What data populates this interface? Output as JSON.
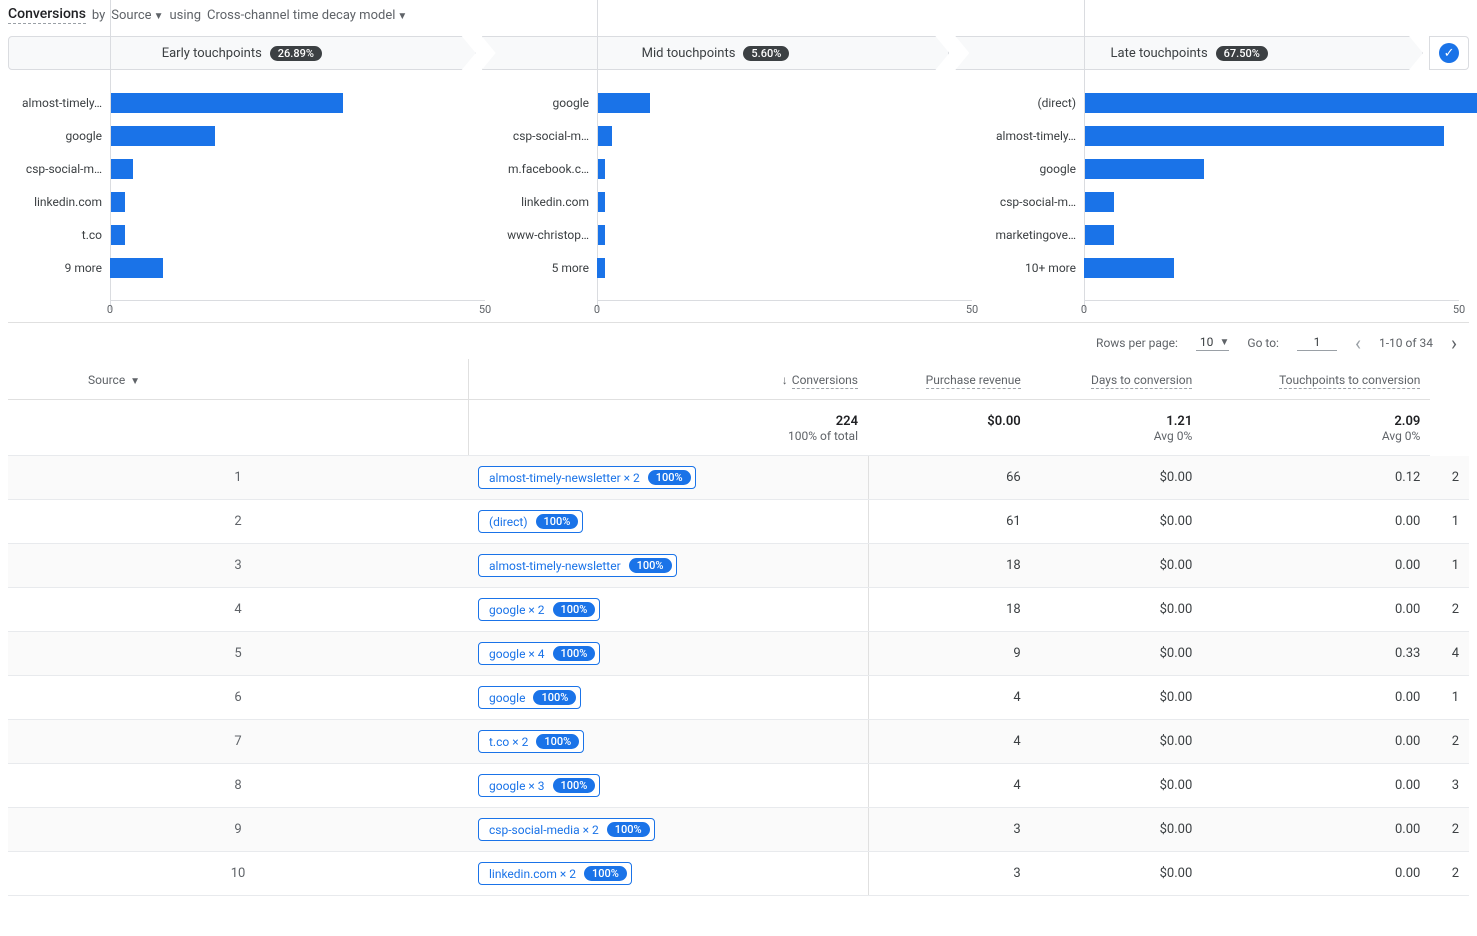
{
  "header": {
    "title_prefix": "Conversions",
    "by": "by",
    "dimension": "Source",
    "using": "using",
    "model": "Cross-channel time decay model"
  },
  "tabs": {
    "early": {
      "label": "Early touchpoints",
      "percent": "26.89%"
    },
    "mid": {
      "label": "Mid touchpoints",
      "percent": "5.60%"
    },
    "late": {
      "label": "Late touchpoints",
      "percent": "67.50%"
    }
  },
  "chart_data": [
    {
      "type": "bar",
      "name": "early",
      "xlim": [
        0,
        50
      ],
      "ticks": [
        0,
        50
      ],
      "categories": [
        "almost-timely…",
        "google",
        "csp-social-m…",
        "linkedin.com",
        "t.co",
        "9 more"
      ],
      "values": [
        31,
        14,
        3,
        2,
        2,
        7
      ]
    },
    {
      "type": "bar",
      "name": "mid",
      "xlim": [
        0,
        50
      ],
      "ticks": [
        0,
        50
      ],
      "categories": [
        "google",
        "csp-social-m…",
        "m.facebook.c…",
        "linkedin.com",
        "www-christop…",
        "5 more"
      ],
      "values": [
        7,
        2,
        1,
        1,
        1,
        1
      ]
    },
    {
      "type": "bar",
      "name": "late",
      "xlim": [
        0,
        50
      ],
      "ticks": [
        0,
        50
      ],
      "categories": [
        "(direct)",
        "almost-timely…",
        "google",
        "csp-social-m…",
        "marketingove…",
        "10+ more"
      ],
      "values": [
        58,
        48,
        16,
        4,
        4,
        12
      ]
    }
  ],
  "pager": {
    "rows_label": "Rows per page:",
    "rows_value": "10",
    "goto_label": "Go to:",
    "goto_value": "1",
    "range": "1-10 of 34"
  },
  "table": {
    "columns": {
      "source": "Source",
      "conversions": "Conversions",
      "revenue": "Purchase revenue",
      "days": "Days to conversion",
      "touchpoints": "Touchpoints to conversion"
    },
    "summary": {
      "conversions": "224",
      "conversions_sub": "100% of total",
      "revenue": "$0.00",
      "revenue_sub": "",
      "days": "1.21",
      "days_sub": "Avg 0%",
      "touchpoints": "2.09",
      "touchpoints_sub": "Avg 0%"
    },
    "rows": [
      {
        "idx": "1",
        "path": "almost-timely-newsletter × 2",
        "badge": "100%",
        "conversions": "66",
        "revenue": "$0.00",
        "days": "0.12",
        "touchpoints": "2"
      },
      {
        "idx": "2",
        "path": "(direct)",
        "badge": "100%",
        "conversions": "61",
        "revenue": "$0.00",
        "days": "0.00",
        "touchpoints": "1"
      },
      {
        "idx": "3",
        "path": "almost-timely-newsletter",
        "badge": "100%",
        "conversions": "18",
        "revenue": "$0.00",
        "days": "0.00",
        "touchpoints": "1"
      },
      {
        "idx": "4",
        "path": "google × 2",
        "badge": "100%",
        "conversions": "18",
        "revenue": "$0.00",
        "days": "0.00",
        "touchpoints": "2"
      },
      {
        "idx": "5",
        "path": "google × 4",
        "badge": "100%",
        "conversions": "9",
        "revenue": "$0.00",
        "days": "0.33",
        "touchpoints": "4"
      },
      {
        "idx": "6",
        "path": "google",
        "badge": "100%",
        "conversions": "4",
        "revenue": "$0.00",
        "days": "0.00",
        "touchpoints": "1"
      },
      {
        "idx": "7",
        "path": "t.co × 2",
        "badge": "100%",
        "conversions": "4",
        "revenue": "$0.00",
        "days": "0.00",
        "touchpoints": "2"
      },
      {
        "idx": "8",
        "path": "google × 3",
        "badge": "100%",
        "conversions": "4",
        "revenue": "$0.00",
        "days": "0.00",
        "touchpoints": "3"
      },
      {
        "idx": "9",
        "path": "csp-social-media × 2",
        "badge": "100%",
        "conversions": "3",
        "revenue": "$0.00",
        "days": "0.00",
        "touchpoints": "2"
      },
      {
        "idx": "10",
        "path": "linkedin.com × 2",
        "badge": "100%",
        "conversions": "3",
        "revenue": "$0.00",
        "days": "0.00",
        "touchpoints": "2"
      }
    ]
  }
}
